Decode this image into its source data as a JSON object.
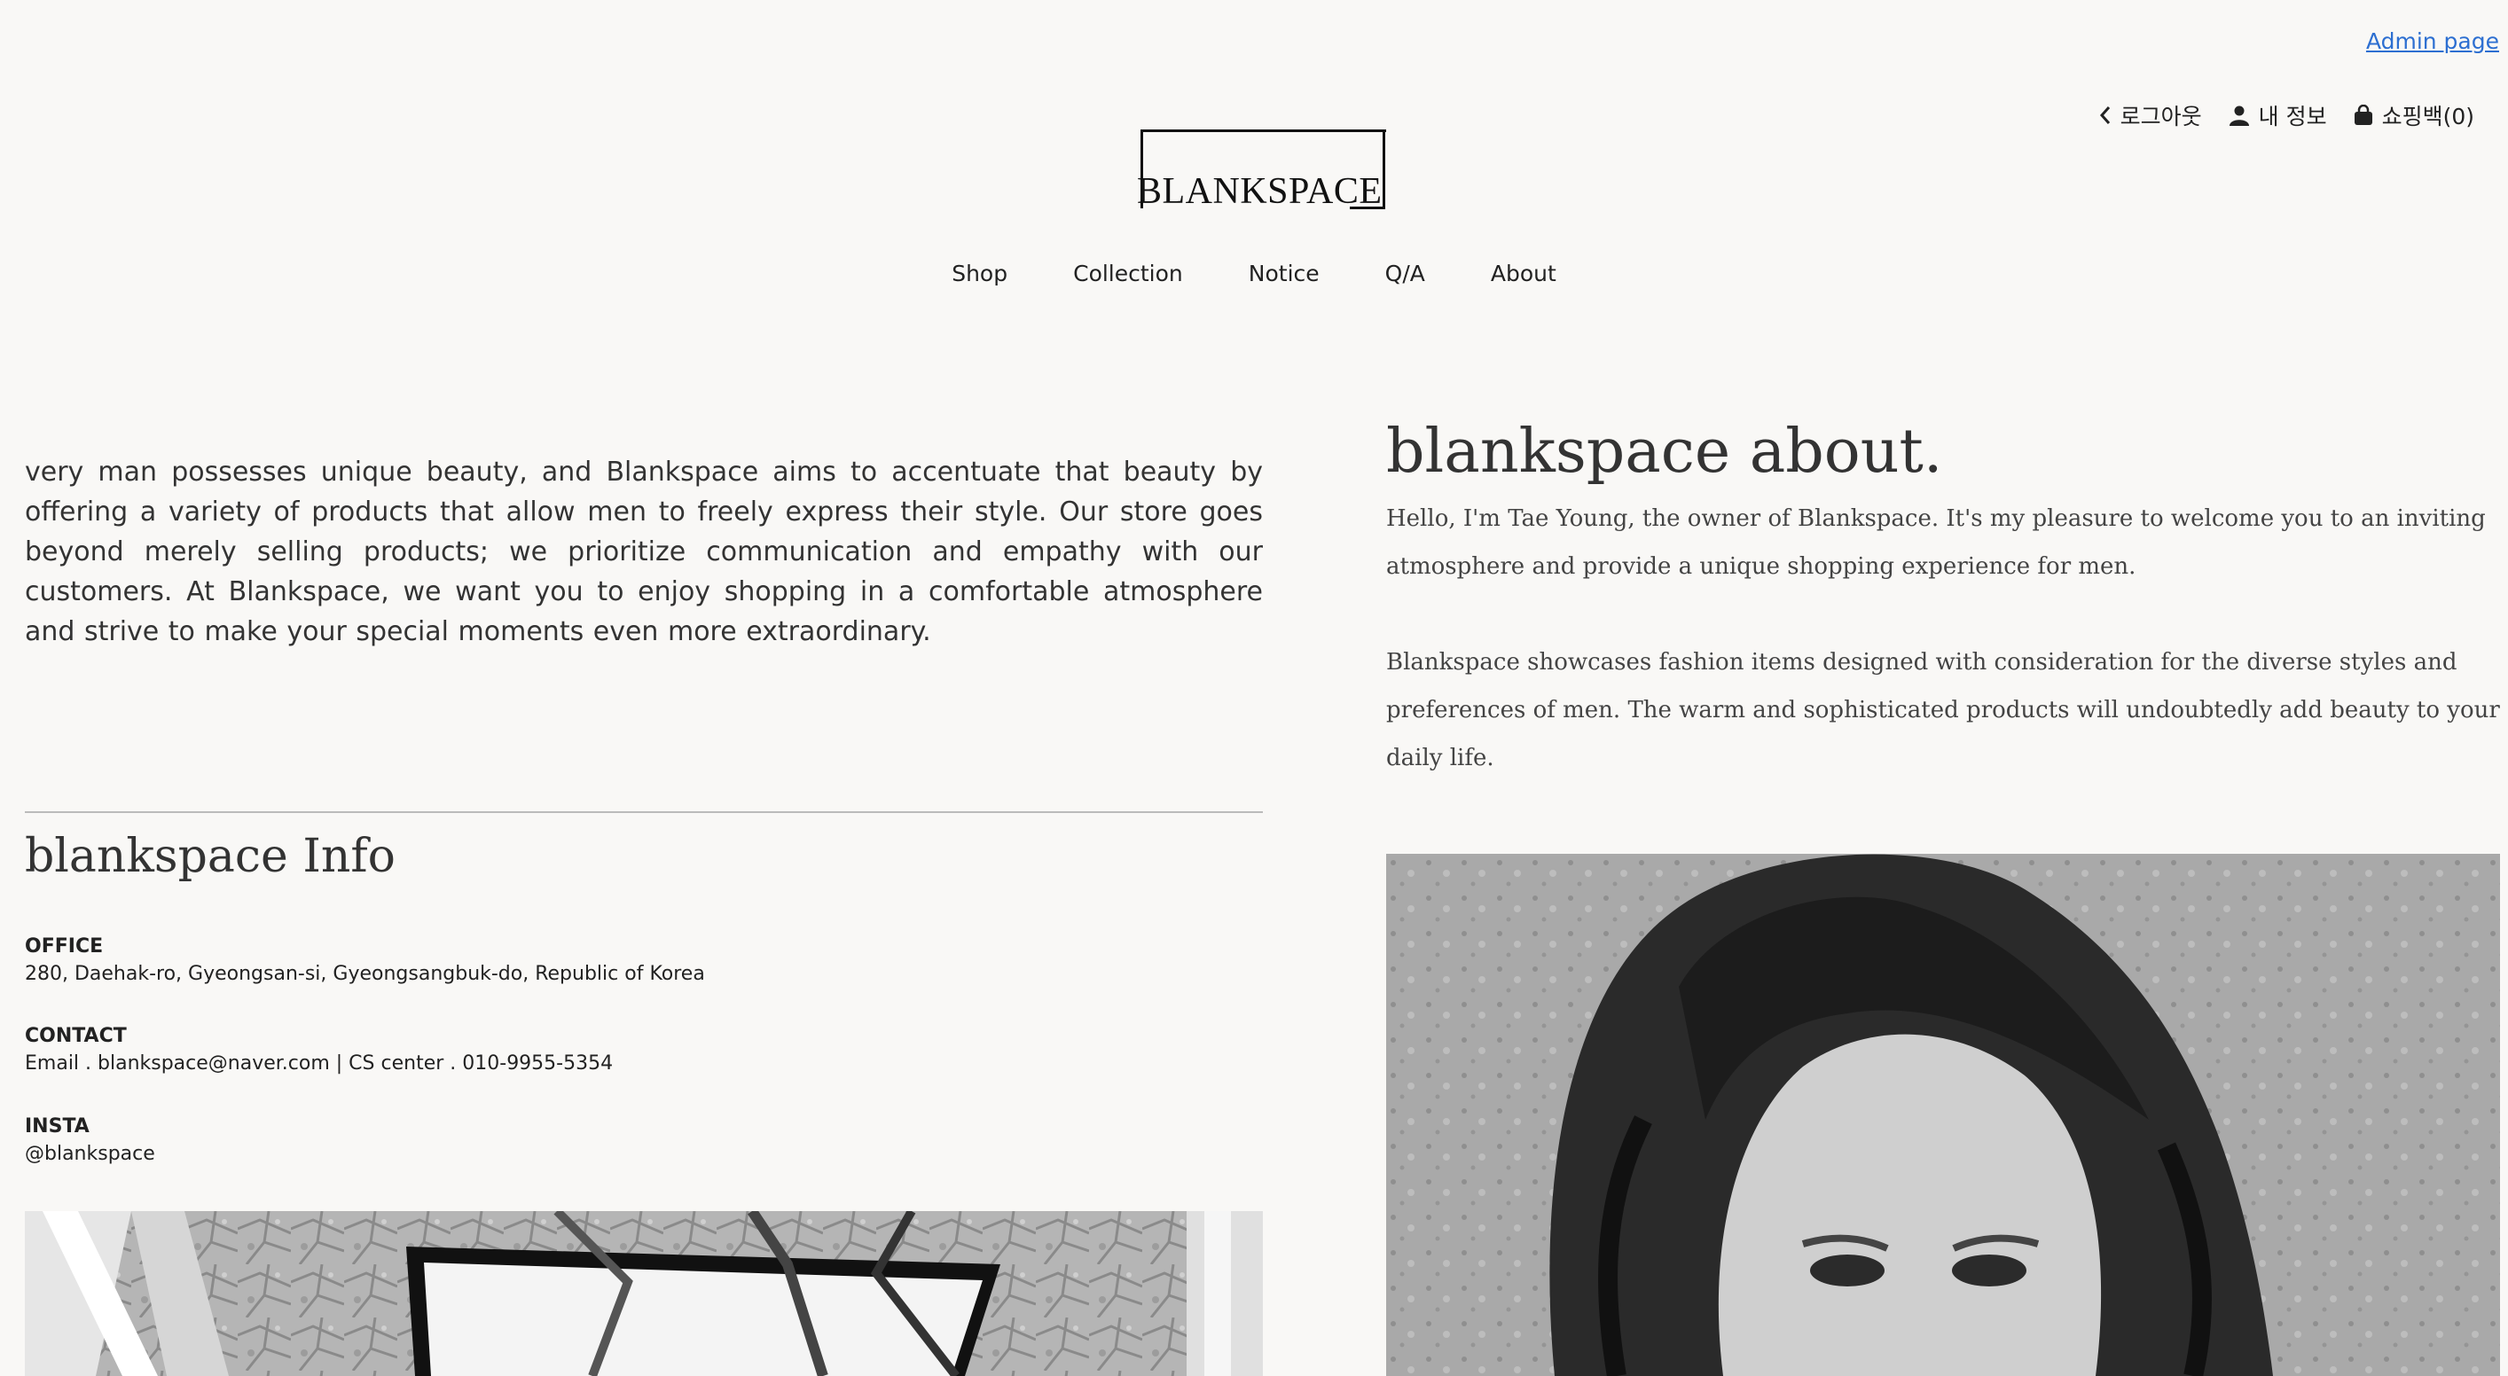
{
  "admin": {
    "label": "Admin page"
  },
  "util_nav": [
    {
      "icon": "chevron-left-icon",
      "label": "로그아웃"
    },
    {
      "icon": "user-icon",
      "label": "내 정보"
    },
    {
      "icon": "bag-icon",
      "label": "쇼핑백(0)"
    }
  ],
  "logo": {
    "text": "BLANKSPACE"
  },
  "nav": [
    "Shop",
    "Collection",
    "Notice",
    "Q/A",
    "About"
  ],
  "intro": "very man possesses unique beauty, and Blankspace aims to accentuate that beauty by offering a variety of products that allow men to freely express their style. Our store goes beyond merely selling products; we prioritize communication and empathy with our customers. At Blankspace, we want you to enjoy shopping in a comfortable atmosphere and strive to make your special moments even more extraordinary.",
  "info": {
    "title": "blankspace Info",
    "office_label": "OFFICE",
    "office_value": "280, Daehak-ro, Gyeongsan-si, Gyeongsangbuk-do, Republic of Korea",
    "contact_label": "CONTACT",
    "contact_value": "Email . blankspace@naver.com | CS center . 010-9955-5354",
    "insta_label": "INSTA",
    "insta_value": "@blankspace"
  },
  "about": {
    "title": "blankspace about.",
    "p1": "Hello, I'm Tae Young, the owner of Blankspace. It's my pleasure to welcome you to an inviting atmosphere and provide a unique shopping experience for men.",
    "p2": "Blankspace showcases fashion items designed with consideration for the diverse styles and preferences of men. The warm and sophisticated products will undoubtedly add beauty to your daily life."
  },
  "colors": {
    "background": "#f9f8f6",
    "link": "#2d6fd1",
    "text": "#222222"
  }
}
